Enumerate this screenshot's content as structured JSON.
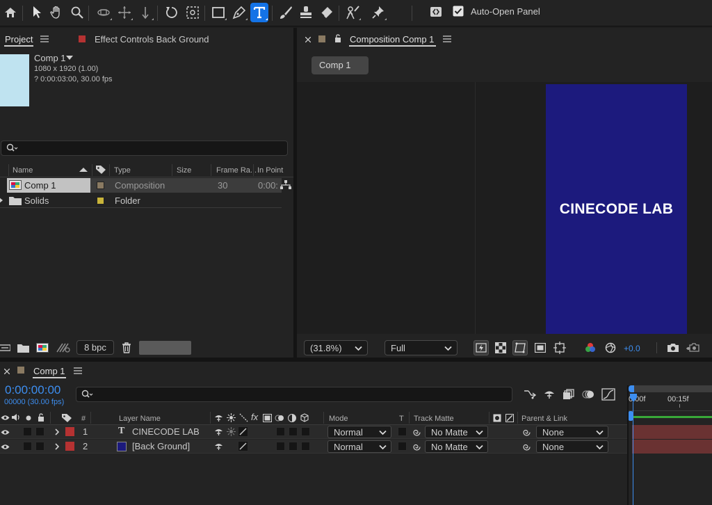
{
  "toolbar": {
    "tools": [
      "home-icon",
      "selection-tool-icon",
      "hand-tool-icon",
      "zoom-tool-icon",
      "orbit-camera-icon",
      "pan-camera-icon",
      "dolly-camera-icon",
      "rotation-tool-icon",
      "pan-behind-tool-icon",
      "rectangle-tool-icon",
      "pen-tool-icon",
      "type-tool-icon",
      "brush-tool-icon",
      "clone-stamp-icon",
      "eraser-tool-icon",
      "roto-brush-icon",
      "puppet-pin-icon"
    ],
    "active_tool": "type-tool-icon",
    "auto_open_label": "Auto-Open Panel",
    "auto_open_checked": true
  },
  "project": {
    "tab_label": "Project",
    "effect_tab_label": "Effect Controls Back Ground",
    "effect_tab_color": "#b53232",
    "comp_name": "Comp 1",
    "comp_dims": "1080 x 1920 (1.00)",
    "comp_duration": "? 0:00:03:00, 30.00 fps",
    "thumb_color": "#bfe3f0",
    "search_placeholder": "",
    "columns": [
      "Name",
      "Type",
      "Size",
      "Frame Ra...",
      "In Point"
    ],
    "rows": [
      {
        "name": "Comp 1",
        "type": "Composition",
        "size": "",
        "frame_rate": "30",
        "in_point": "0:00:",
        "label_color": "#8a7a62",
        "selected": true
      },
      {
        "name": "Solids",
        "type": "Folder",
        "size": "",
        "frame_rate": "",
        "in_point": "",
        "label_color": "#c9b43a",
        "selected": false
      }
    ],
    "bpc_label": "8 bpc"
  },
  "composition": {
    "tab_label": "Composition Comp 1",
    "tab_swatch_color": "#8a7a62",
    "comp_button_label": "Comp 1",
    "canvas_color": "#1c1a7d",
    "canvas_text": "CINECODE LAB",
    "zoom_label": "(31.8%)",
    "resolution_label": "Full",
    "exposure_value": "+0.0"
  },
  "timeline": {
    "tab_label": "Comp 1",
    "tab_swatch_color": "#8a7a62",
    "timecode": "0:00:00:00",
    "frame_info": "00000 (30.00 fps)",
    "search_placeholder": "",
    "ruler_labels": [
      "0:00f",
      "00:15f"
    ],
    "columns": {
      "hash": "#",
      "layer_name": "Layer Name",
      "mode": "Mode",
      "t": "T",
      "track_matte": "Track Matte",
      "parent": "Parent & Link"
    },
    "layers": [
      {
        "index": "1",
        "name": "CINECODE LAB",
        "type_icon": "T",
        "label_color": "#b53232",
        "mode": "Normal",
        "matte": "No Matte",
        "parent": "None",
        "bar_color": "#6a3232"
      },
      {
        "index": "2",
        "name": "[Back Ground]",
        "type_icon": "",
        "label_color": "#b53232",
        "solid_color": "#1c1a7d",
        "mode": "Normal",
        "matte": "No Matte",
        "parent": "None",
        "bar_color": "#6a3232"
      }
    ]
  }
}
